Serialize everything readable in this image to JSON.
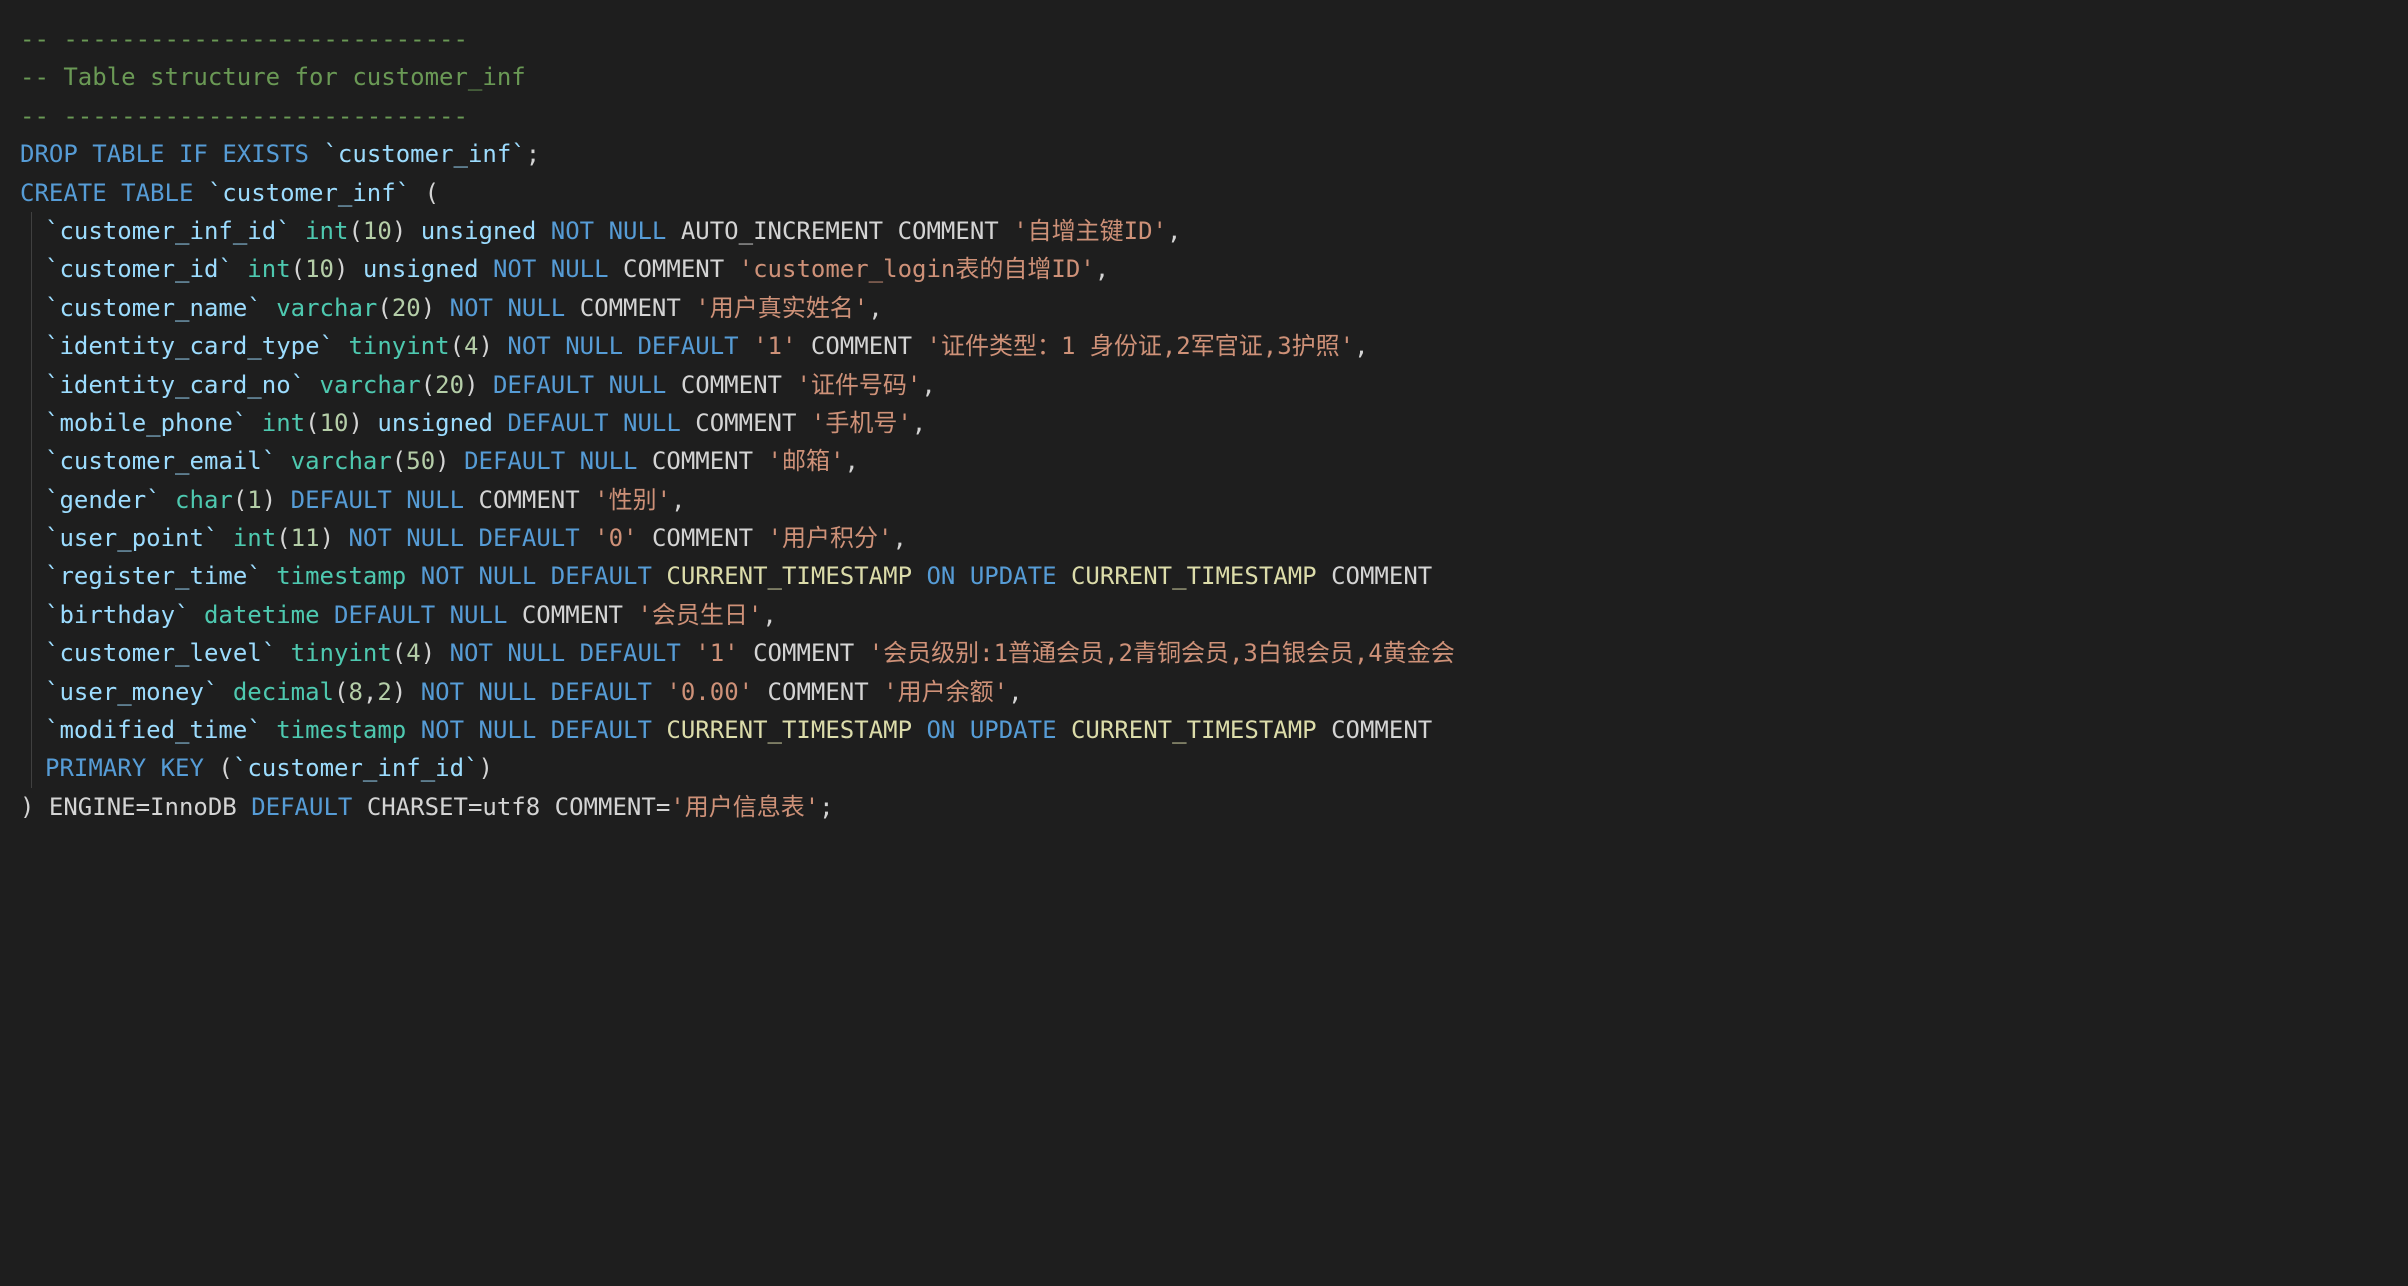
{
  "lines": {
    "0": {
      "comment": "-- ----------------------------"
    },
    "1": {
      "comment": "-- Table structure for customer_inf"
    },
    "2": {
      "comment": "-- ----------------------------"
    },
    "3": {
      "tokens": [
        "DROP",
        "TABLE",
        "IF",
        "EXISTS",
        "`customer_inf`"
      ]
    },
    "4": {
      "tokens": [
        "CREATE",
        "TABLE",
        "`customer_inf`"
      ]
    },
    "5": {
      "col": "`customer_inf_id`",
      "type": "int",
      "size": "10",
      "unsigned": "unsigned",
      "not": "NOT",
      "null": "NULL",
      "auto": "AUTO_INCREMENT",
      "comment_kw": "COMMENT",
      "comment": "'自增主键ID'"
    },
    "6": {
      "col": "`customer_id`",
      "type": "int",
      "size": "10",
      "unsigned": "unsigned",
      "not": "NOT",
      "null": "NULL",
      "comment_kw": "COMMENT",
      "comment": "'customer_login表的自增ID'"
    },
    "7": {
      "col": "`customer_name`",
      "type": "varchar",
      "size": "20",
      "not": "NOT",
      "null": "NULL",
      "comment_kw": "COMMENT",
      "comment": "'用户真实姓名'"
    },
    "8": {
      "col": "`identity_card_type`",
      "type": "tinyint",
      "size": "4",
      "not": "NOT",
      "null": "NULL",
      "default_kw": "DEFAULT",
      "default_val": "'1'",
      "comment_kw": "COMMENT",
      "comment": "'证件类型：1 身份证,2军官证,3护照'"
    },
    "9": {
      "col": "`identity_card_no`",
      "type": "varchar",
      "size": "20",
      "default_kw": "DEFAULT",
      "null": "NULL",
      "comment_kw": "COMMENT",
      "comment": "'证件号码'"
    },
    "10": {
      "col": "`mobile_phone`",
      "type": "int",
      "size": "10",
      "unsigned": "unsigned",
      "default_kw": "DEFAULT",
      "null": "NULL",
      "comment_kw": "COMMENT",
      "comment": "'手机号'"
    },
    "11": {
      "col": "`customer_email`",
      "type": "varchar",
      "size": "50",
      "default_kw": "DEFAULT",
      "null": "NULL",
      "comment_kw": "COMMENT",
      "comment": "'邮箱'"
    },
    "12": {
      "col": "`gender`",
      "type": "char",
      "size": "1",
      "default_kw": "DEFAULT",
      "null": "NULL",
      "comment_kw": "COMMENT",
      "comment": "'性别'"
    },
    "13": {
      "col": "`user_point`",
      "type": "int",
      "size": "11",
      "not": "NOT",
      "null": "NULL",
      "default_kw": "DEFAULT",
      "default_val": "'0'",
      "comment_kw": "COMMENT",
      "comment": "'用户积分'"
    },
    "14": {
      "col": "`register_time`",
      "type": "timestamp",
      "not": "NOT",
      "null": "NULL",
      "default_kw": "DEFAULT",
      "default_val": "CURRENT_TIMESTAMP",
      "on": "ON",
      "update": "UPDATE",
      "update_val": "CURRENT_TIMESTAMP",
      "comment_kw": "COMMENT"
    },
    "15": {
      "col": "`birthday`",
      "type": "datetime",
      "default_kw": "DEFAULT",
      "null": "NULL",
      "comment_kw": "COMMENT",
      "comment": "'会员生日'"
    },
    "16": {
      "col": "`customer_level`",
      "type": "tinyint",
      "size": "4",
      "not": "NOT",
      "null": "NULL",
      "default_kw": "DEFAULT",
      "default_val": "'1'",
      "comment_kw": "COMMENT",
      "comment": "'会员级别:1普通会员,2青铜会员,3白银会员,4黄金会"
    },
    "17": {
      "col": "`user_money`",
      "type": "decimal",
      "size1": "8",
      "size2": "2",
      "not": "NOT",
      "null": "NULL",
      "default_kw": "DEFAULT",
      "default_val": "'0.00'",
      "comment_kw": "COMMENT",
      "comment": "'用户余额'"
    },
    "18": {
      "col": "`modified_time`",
      "type": "timestamp",
      "not": "NOT",
      "null": "NULL",
      "default_kw": "DEFAULT",
      "default_val": "CURRENT_TIMESTAMP",
      "on": "ON",
      "update": "UPDATE",
      "update_val": "CURRENT_TIMESTAMP",
      "comment_kw": "COMMENT"
    },
    "19": {
      "primary": "PRIMARY",
      "key": "KEY",
      "col": "`customer_inf_id`"
    },
    "20": {
      "engine": "ENGINE=InnoDB",
      "default_kw": "DEFAULT",
      "charset": "CHARSET=utf8",
      "comment_kw": "COMMENT",
      "comment": "'用户信息表'"
    }
  }
}
